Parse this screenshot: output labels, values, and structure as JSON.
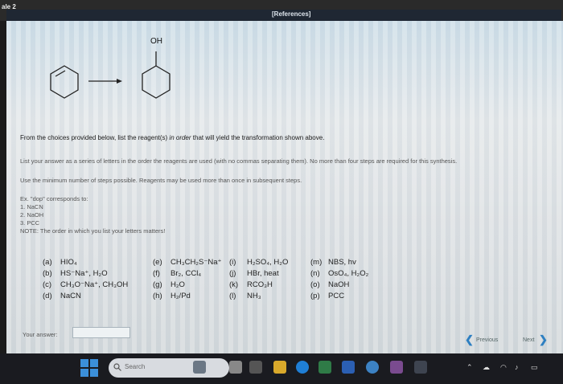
{
  "header": {
    "question_label": "ale 2",
    "references": "[References]"
  },
  "reaction": {
    "substituent": "OH"
  },
  "instructions": {
    "main_before": "From the choices provided below, list the reagent(s) ",
    "main_italic": "in order",
    "main_after": " that will yield the transformation shown above.",
    "sub1": "List your answer as a series of letters in the order the reagents are used (with no commas separating them). No more than four steps are required for this synthesis.",
    "sub2": "Use the minimum number of steps possible. Reagents may be used more than once in subsequent steps."
  },
  "example": {
    "line0": "Ex. \"dop\" corresponds to:",
    "line1": "1. NaCN",
    "line2": "2. NaOH",
    "line3": "3. PCC",
    "note": "NOTE: The order in which you list your letters matters!"
  },
  "choices": {
    "a": {
      "code": "(a)",
      "label": "HIO₄"
    },
    "b": {
      "code": "(b)",
      "label": "HS⁻Na⁺, H₂O"
    },
    "c": {
      "code": "(c)",
      "label": "CH₃O⁻Na⁺, CH₃OH"
    },
    "d": {
      "code": "(d)",
      "label": "NaCN"
    },
    "e": {
      "code": "(e)",
      "label": "CH₃CH₂S⁻Na⁺"
    },
    "f": {
      "code": "(f)",
      "label": "Br₂, CCl₄"
    },
    "g": {
      "code": "(g)",
      "label": "H₂O"
    },
    "h": {
      "code": "(h)",
      "label": "H₂/Pd"
    },
    "i": {
      "code": "(i)",
      "label": "H₂SO₄, H₂O"
    },
    "j": {
      "code": "(j)",
      "label": "HBr, heat"
    },
    "k": {
      "code": "(k)",
      "label": "RCO₃H"
    },
    "l": {
      "code": "(l)",
      "label": "NH₃"
    },
    "m": {
      "code": "(m)",
      "label": "NBS, hv"
    },
    "n": {
      "code": "(n)",
      "label": "OsO₄, H₂O₂"
    },
    "o": {
      "code": "(o)",
      "label": "NaOH"
    },
    "p": {
      "code": "(p)",
      "label": "PCC"
    }
  },
  "answer": {
    "label": "Your answer:",
    "value": ""
  },
  "nav": {
    "previous": "Previous",
    "next": "Next"
  },
  "taskbar": {
    "search_placeholder": "Search"
  },
  "colors": {
    "accent": "#2d7fc1",
    "references_bar": "#1f2733"
  }
}
